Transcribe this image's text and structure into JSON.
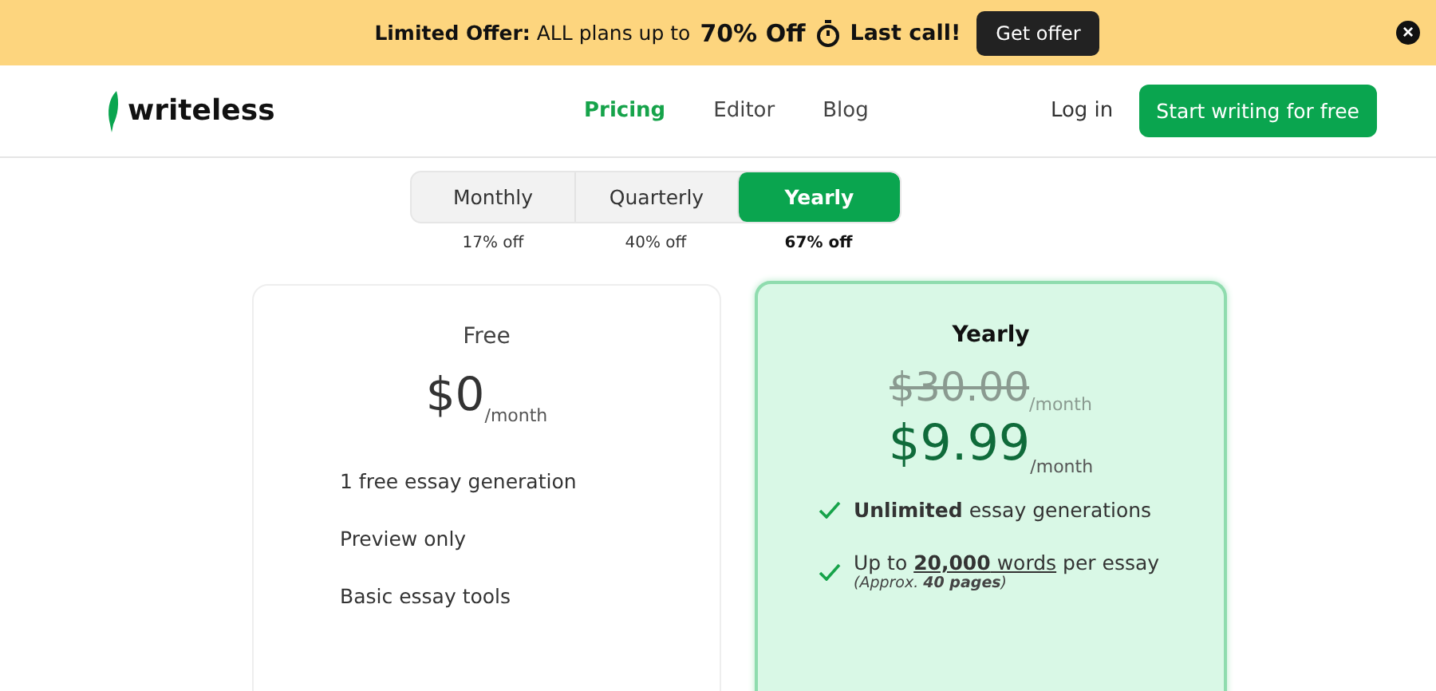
{
  "banner": {
    "text": "**Limited Offer:** ALL plans up to",
    "highlight": "70% Off",
    "cta_text": "Last call!",
    "button": "Get offer",
    "close": "×"
  },
  "nav": {
    "brand": "writeless",
    "links": [
      {
        "label": "Pricing",
        "selected": true
      },
      {
        "label": "Editor",
        "selected": false
      },
      {
        "label": "Blog",
        "selected": false
      }
    ],
    "login": "Log in",
    "cta": "Start writing for free"
  },
  "billing": [
    {
      "label": "Monthly",
      "discount": "17% off",
      "selected": false
    },
    {
      "label": "Quarterly",
      "discount": "40% off",
      "selected": false
    },
    {
      "label": "Yearly",
      "discount": "67% off",
      "selected": true
    }
  ],
  "plans": [
    {
      "name": "Free",
      "highlighted": false,
      "price": "$0",
      "unit": "/month",
      "features": [
        {
          "text": "1 free essay generation",
          "check": false
        },
        {
          "text": "Preview only",
          "check": false
        },
        {
          "text": "Basic essay tools",
          "check": false
        }
      ]
    },
    {
      "name": "Yearly",
      "highlighted": true,
      "old_price": "$30.00",
      "old_unit": "/month",
      "price": "$9.99",
      "unit": "/month",
      "features": [
        {
          "text": "**Unlimited** essay generations",
          "check": true
        },
        {
          "text": "Up to ",
          "link": "**20,000** words",
          "after": " per essay",
          "note": "(Approx. **40 pages**)",
          "check": true
        }
      ]
    }
  ]
}
